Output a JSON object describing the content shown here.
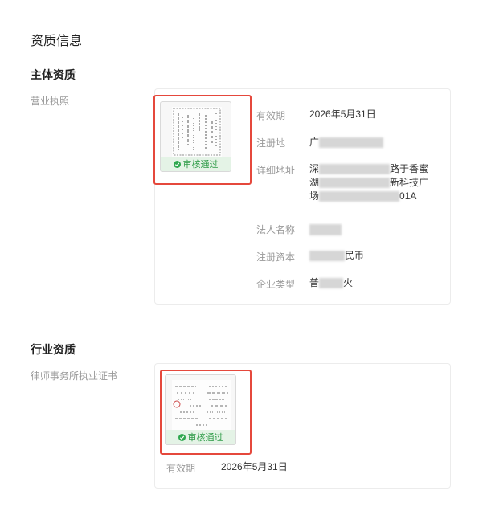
{
  "page": {
    "title": "资质信息"
  },
  "subject": {
    "title": "主体资质",
    "license": {
      "label": "营业执照",
      "badge": "审核通过",
      "details": {
        "validity_label": "有效期",
        "validity_value": "2026年5月31日",
        "reg_place_label": "注册地",
        "reg_place_prefix": "广",
        "address_label": "详细地址",
        "address_line1_prefix": "深",
        "address_line1_suffix": "路于香蜜",
        "address_line2_prefix": "湖",
        "address_line2_suffix": "新科技广",
        "address_line3_prefix": "场",
        "address_line3_suffix": "01A",
        "legal_label": "法人名称",
        "capital_label": "注册资本",
        "capital_suffix": "民币",
        "type_label": "企业类型",
        "type_prefix": "普",
        "type_suffix": "火"
      }
    }
  },
  "industry": {
    "title": "行业资质",
    "certificate": {
      "label": "律师事务所执业证书",
      "badge": "审核通过",
      "validity_label": "有效期",
      "validity_value": "2026年5月31日"
    }
  },
  "colors": {
    "highlight": "#e5483c",
    "approved": "#2fa84f",
    "approved_bg": "#e4f3e6"
  }
}
